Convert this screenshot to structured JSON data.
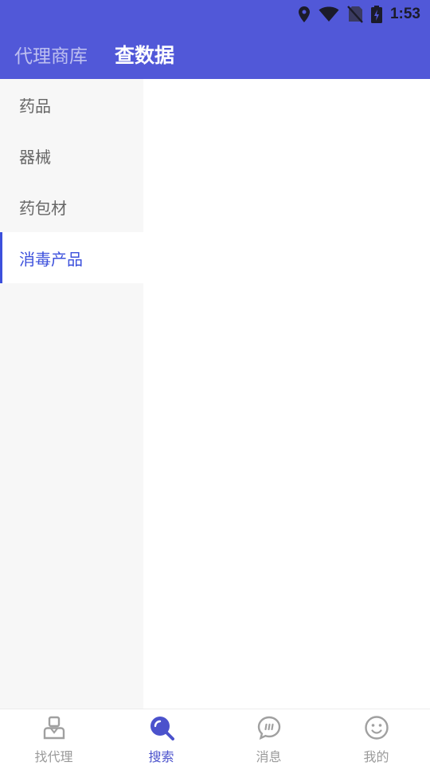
{
  "status_bar": {
    "time": "1:53"
  },
  "header": {
    "tabs": [
      {
        "label": "代理商库"
      },
      {
        "label": "查数据"
      }
    ]
  },
  "sidebar": {
    "items": [
      {
        "label": "药品"
      },
      {
        "label": "器械"
      },
      {
        "label": "药包材"
      },
      {
        "label": "消毒产品"
      }
    ]
  },
  "bottom_nav": {
    "items": [
      {
        "label": "找代理",
        "icon": "agent-icon"
      },
      {
        "label": "搜索",
        "icon": "search-icon"
      },
      {
        "label": "消息",
        "icon": "message-icon"
      },
      {
        "label": "我的",
        "icon": "smiley-icon"
      }
    ]
  },
  "colors": {
    "primary": "#5158d8",
    "accent": "#3c50dc",
    "sidebar_bg": "#f7f7f7",
    "inactive_gray": "#9a9a9a"
  }
}
